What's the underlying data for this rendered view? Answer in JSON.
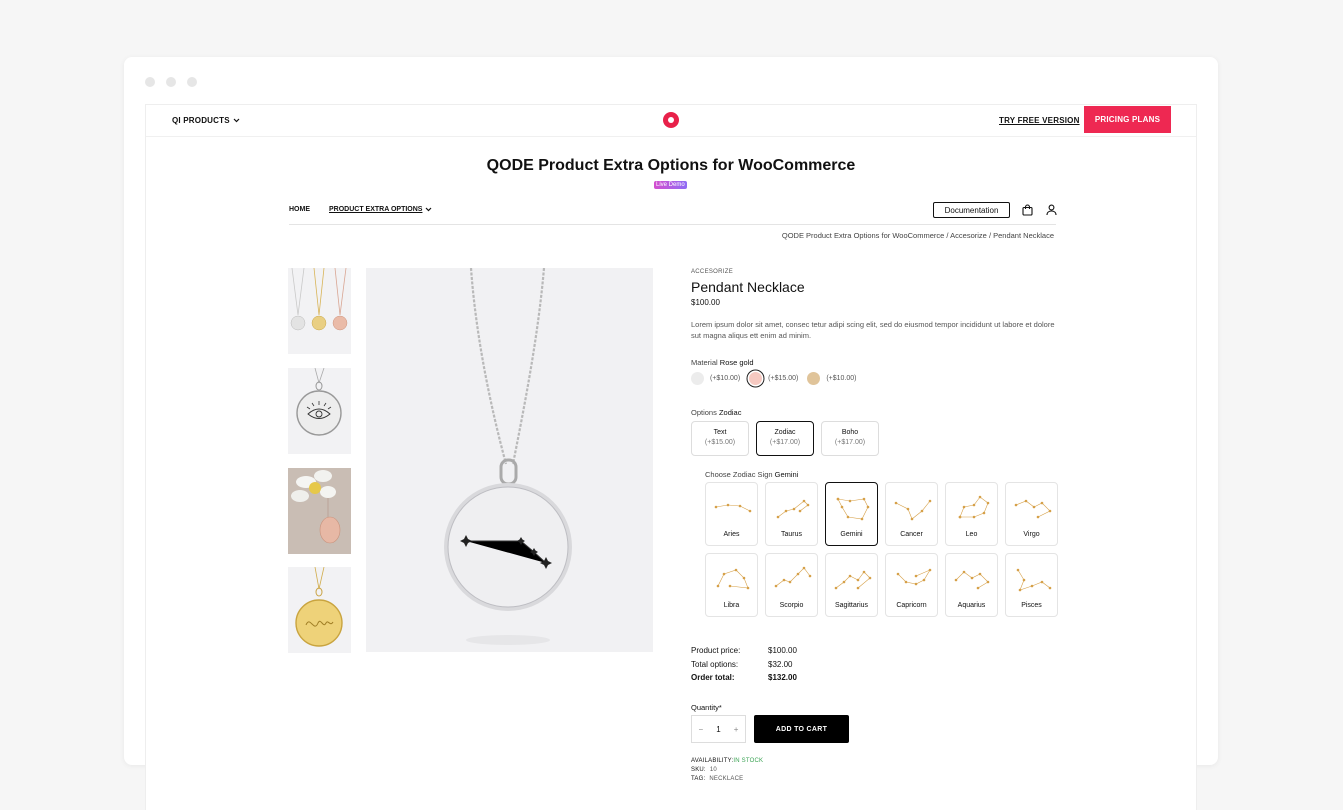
{
  "window": {
    "dots": 3
  },
  "topbar": {
    "products_label": "QI PRODUCTS",
    "try_free": "TRY FREE VERSION",
    "pricing": "PRICING PLANS",
    "brand_color": "#ee2852"
  },
  "page": {
    "title": "QODE Product Extra Options for WooCommerce",
    "badge": "Live Demo"
  },
  "shopnav": {
    "home": "HOME",
    "extra": "PRODUCT EXTRA OPTIONS",
    "documentation": "Documentation"
  },
  "breadcrumb": {
    "items": [
      "QODE Product Extra Options for WooCommerce",
      "Accesorize",
      "Pendant Necklace"
    ],
    "sep": "/"
  },
  "product": {
    "category": "ACCESORIZE",
    "name": "Pendant Necklace",
    "price": "$100.00",
    "description": "Lorem ipsum dolor sit amet, consec tetur adipi scing elit, sed do eiusmod tempor incididunt ut labore et dolore sut magna aliqus ett enim ad minim."
  },
  "material": {
    "label": "Material",
    "selected": "Rose gold",
    "swatches": [
      {
        "color": "#ececec",
        "price": "(+$10.00)"
      },
      {
        "color": "#f6c9c1",
        "price": "(+$15.00)"
      },
      {
        "color": "#e0c49a",
        "price": "(+$10.00)"
      }
    ]
  },
  "options": {
    "label": "Options",
    "selected": "Zodiac",
    "cards": [
      {
        "name": "Text",
        "price": "(+$15.00)"
      },
      {
        "name": "Zodiac",
        "price": "(+$17.00)"
      },
      {
        "name": "Boho",
        "price": "(+$17.00)"
      }
    ]
  },
  "zodiac": {
    "label": "Choose Zodiac Sign",
    "selected": "Gemini",
    "star_color": "#d6a048",
    "signs": [
      "Aries",
      "Taurus",
      "Gemini",
      "Cancer",
      "Leo",
      "Virgo",
      "Libra",
      "Scorpio",
      "Sagittarius",
      "Capricorn",
      "Aquarius",
      "Pisces"
    ]
  },
  "totals": {
    "product_price_label": "Product price:",
    "product_price": "$100.00",
    "total_options_label": "Total options:",
    "total_options": "$32.00",
    "order_total_label": "Order total:",
    "order_total": "$132.00"
  },
  "cart": {
    "quantity_label": "Quantity*",
    "quantity": "1",
    "minus": "−",
    "plus": "+",
    "add_to_cart": "ADD TO CART"
  },
  "meta": {
    "availability_label": "AVAILABILITY:",
    "availability": "IN STOCK",
    "sku_label": "SKU:",
    "sku": "10",
    "tag_label": "TAG:",
    "tag": "NECKLACE"
  }
}
